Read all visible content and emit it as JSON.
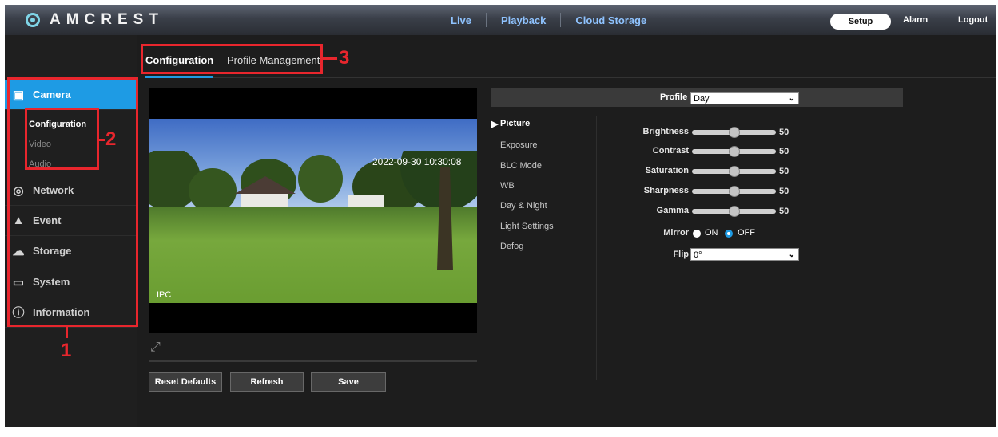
{
  "header": {
    "logo_text": "AMCREST",
    "nav": [
      "Live",
      "Playback",
      "Cloud Storage"
    ],
    "setup_label": "Setup",
    "alarm_label": "Alarm",
    "logout_label": "Logout"
  },
  "tabs": [
    {
      "label": "Configuration",
      "active": true
    },
    {
      "label": "Profile Management",
      "active": false
    }
  ],
  "sidebar": {
    "items": [
      {
        "label": "Camera",
        "icon": "camera-icon",
        "active": true
      },
      {
        "label": "Network",
        "icon": "globe-icon",
        "active": false
      },
      {
        "label": "Event",
        "icon": "alarm-icon",
        "active": false
      },
      {
        "label": "Storage",
        "icon": "cloud-icon",
        "active": false
      },
      {
        "label": "System",
        "icon": "monitor-icon",
        "active": false
      },
      {
        "label": "Information",
        "icon": "info-icon",
        "active": false
      }
    ],
    "sub_items": [
      {
        "label": "Configuration",
        "active": true
      },
      {
        "label": "Video",
        "active": false
      },
      {
        "label": "Audio",
        "active": false
      }
    ]
  },
  "annotations": [
    "1",
    "2",
    "3"
  ],
  "video": {
    "timestamp": "2022-09-30 10:30:08",
    "channel_name": "IPC"
  },
  "buttons": {
    "reset": "Reset Defaults",
    "refresh": "Refresh",
    "save": "Save"
  },
  "profile": {
    "label": "Profile",
    "value": "Day"
  },
  "submenu": [
    "Picture",
    "Exposure",
    "BLC Mode",
    "WB",
    "Day & Night",
    "Light Settings",
    "Defog"
  ],
  "picture": {
    "params": [
      {
        "label": "Brightness",
        "value": "50"
      },
      {
        "label": "Contrast",
        "value": "50"
      },
      {
        "label": "Saturation",
        "value": "50"
      },
      {
        "label": "Sharpness",
        "value": "50"
      },
      {
        "label": "Gamma",
        "value": "50"
      }
    ],
    "mirror": {
      "label": "Mirror",
      "on_label": "ON",
      "off_label": "OFF",
      "selected": "OFF"
    },
    "flip": {
      "label": "Flip",
      "value": "0°"
    }
  },
  "colors": {
    "accent": "#1e9be4",
    "annotation": "#e8262d",
    "nav_link": "#8fc3ff"
  }
}
